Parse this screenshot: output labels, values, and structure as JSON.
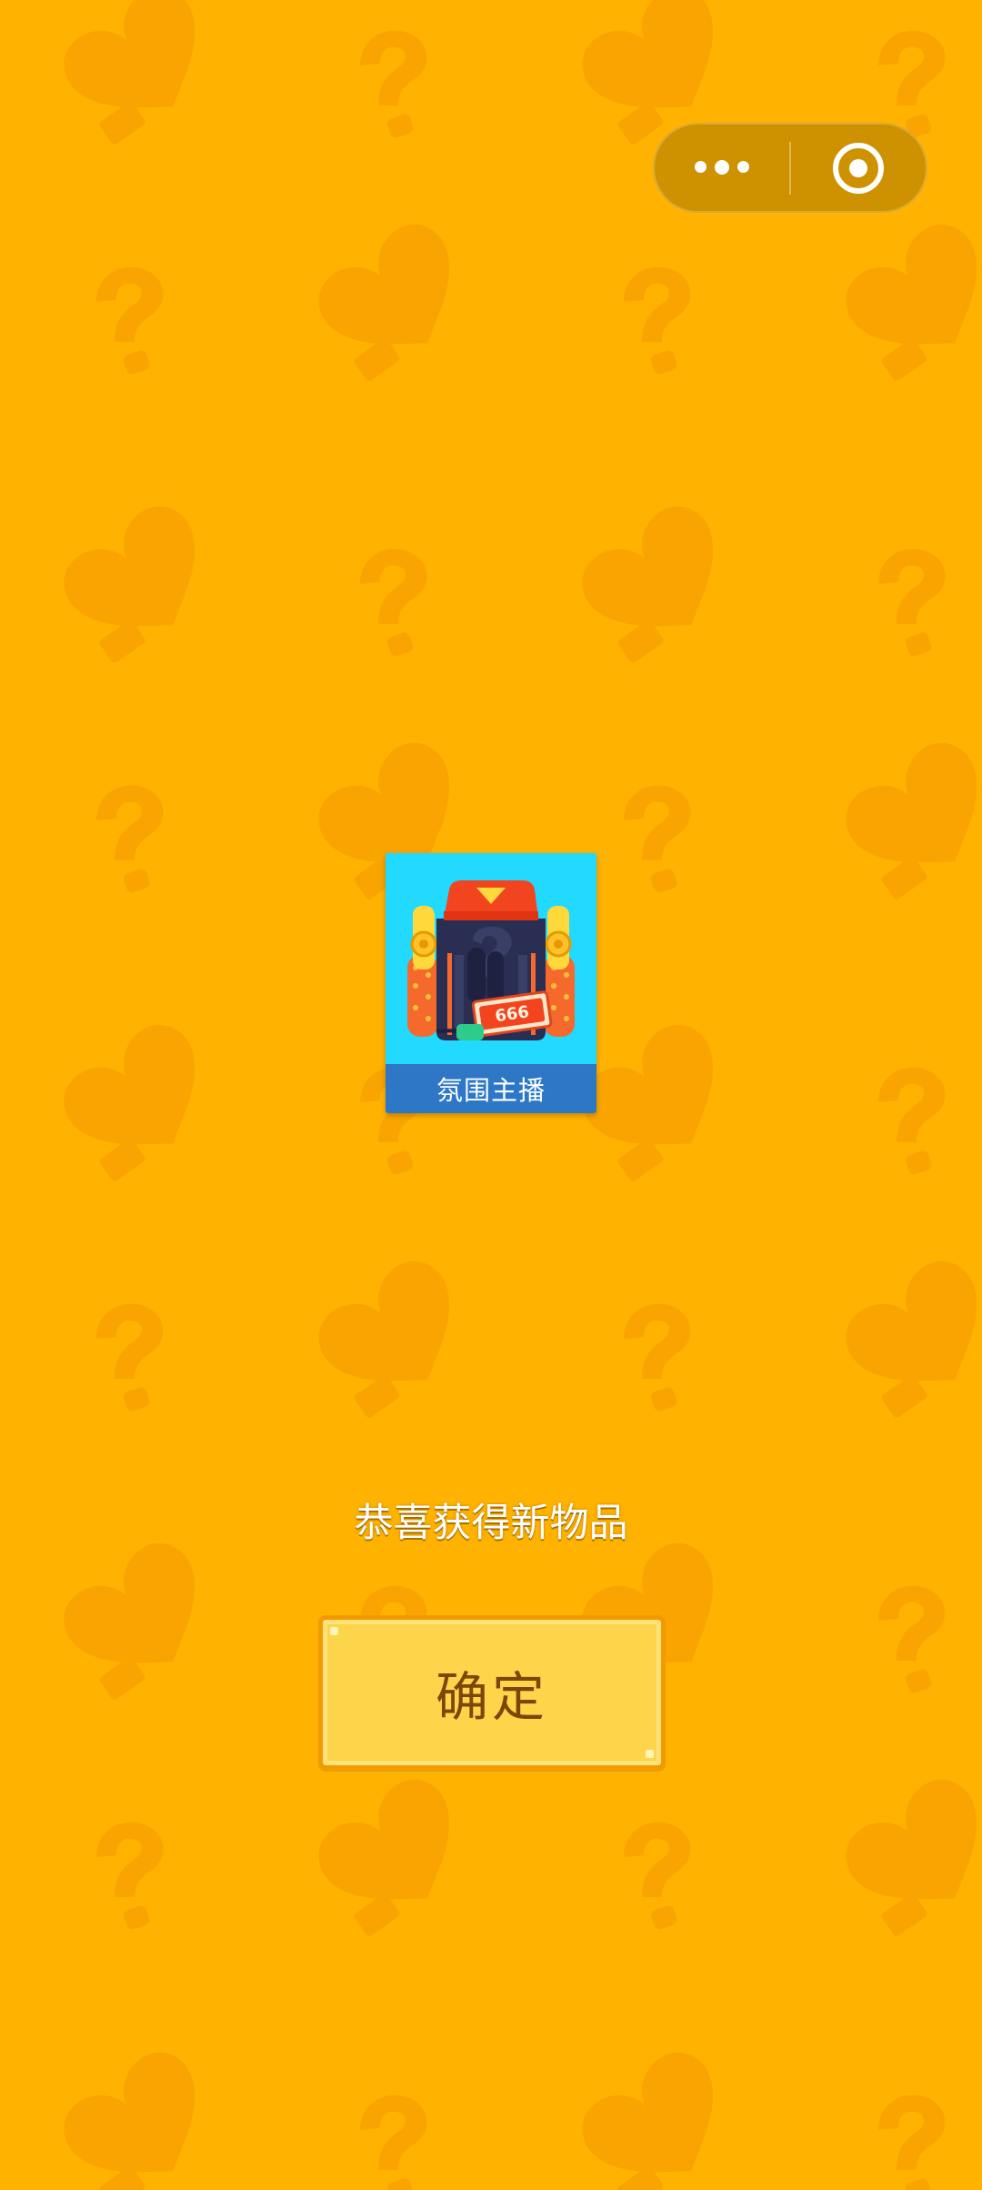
{
  "capsule": {
    "more_icon": "more-dots-icon",
    "close_icon": "target-circle-icon"
  },
  "reward": {
    "item_name": "氛围主播",
    "item_badge_text": "666",
    "message": "恭喜获得新物品"
  },
  "actions": {
    "confirm_label": "确定"
  },
  "colors": {
    "background": "#FFB300",
    "pattern": "#F9A400",
    "capsule": "#CE9100",
    "card_bg": "#22D9FF",
    "label_bar": "#2D77C6",
    "button_fill": "#FDD54A",
    "button_border": "#F39A00",
    "button_text": "#7A4704"
  }
}
